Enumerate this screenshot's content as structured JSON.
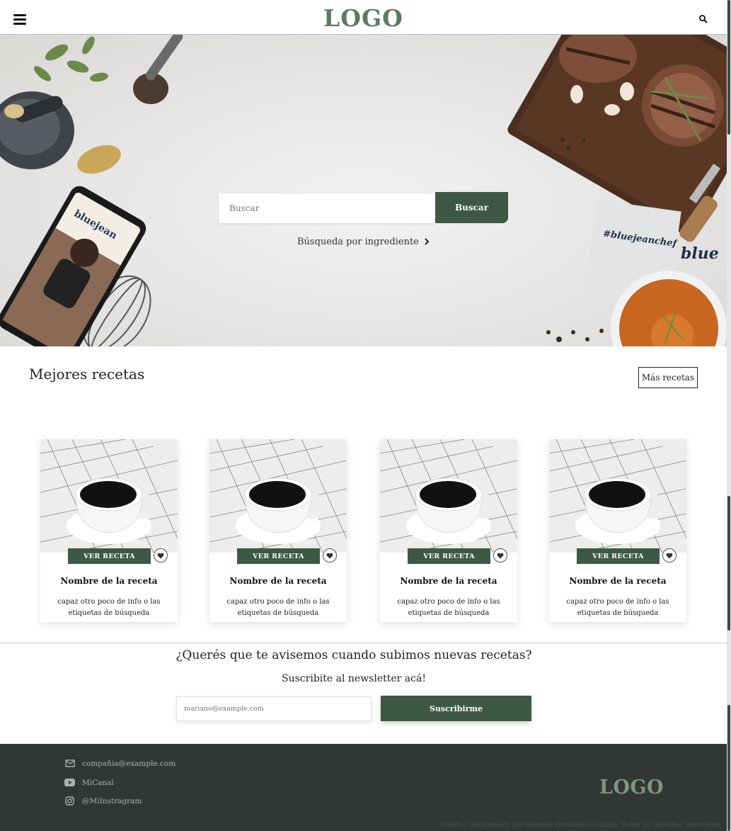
{
  "header": {
    "logo": "LOGO"
  },
  "hero": {
    "search_placeholder": "Buscar",
    "search_button": "Buscar",
    "ingredient_link": "Búsqueda por ingrediente",
    "phone_brand": "bluejean",
    "card_tag": "#bluejeanchef",
    "card_brand": "blue"
  },
  "best": {
    "title": "Mejores recetas",
    "more_button": "Más recetas"
  },
  "cards": [
    {
      "button": "VER RECETA",
      "name": "Nombre de la receta",
      "desc": "capaz otro poco de info o las etiquetas de búsqueda"
    },
    {
      "button": "VER RECETA",
      "name": "Nombre de la receta",
      "desc": "capaz otro poco de info o las etiquetas de búsqueda"
    },
    {
      "button": "VER RECETA",
      "name": "Nombre de la receta",
      "desc": "capaz otro poco de info o las etiquetas de búsqueda"
    },
    {
      "button": "VER RECETA",
      "name": "Nombre de la receta",
      "desc": "capaz otro poco de info o las etiquetas de búsqueda"
    }
  ],
  "newsletter": {
    "question": "¿Querés que te avisemos cuando subimos nuevas recetas?",
    "subtitle": "Suscribite al newsletter acá!",
    "email_placeholder": "mariano@example.com",
    "button": "Suscribirme"
  },
  "footer": {
    "email": "compañia@example.com",
    "youtube": "MiCanal",
    "instagram": "@MiInstragram",
    "logo": "LOGO",
    "copyright": "Diseño y desarrollado por Mariano Fernandez Guiñazu. Todos los derechos reservados"
  },
  "colors": {
    "brand_green": "#3e5847",
    "logo_green": "#5c7a66",
    "footer_bg": "#333734"
  },
  "icons": [
    "menu-icon",
    "search-icon",
    "chevron-right-icon",
    "heart-icon",
    "mail-icon",
    "youtube-icon",
    "instagram-icon"
  ]
}
